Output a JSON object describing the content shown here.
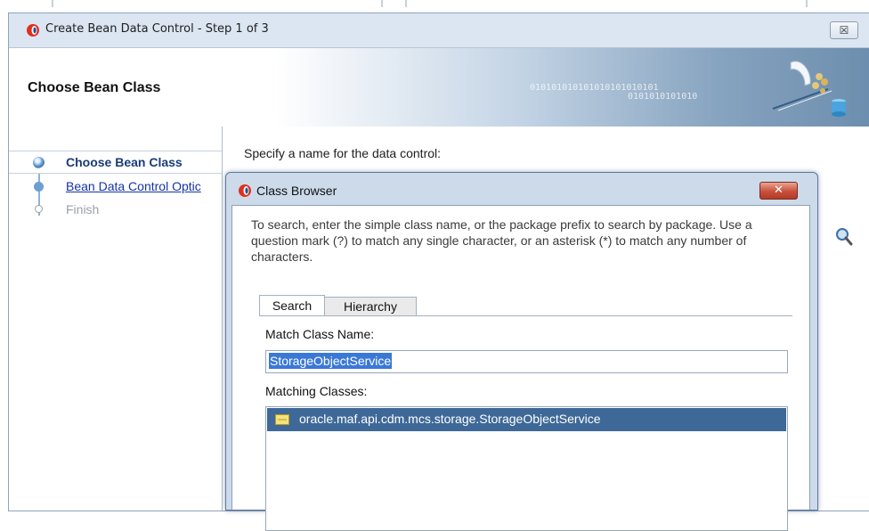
{
  "wizard": {
    "title": "Create Bean Data Control - Step 1 of 3",
    "close_label": "☒",
    "header_title": "Choose Bean Class",
    "header_binary_1": "010101010101010101010101",
    "header_binary_2": "0101010101010"
  },
  "steps": [
    {
      "label": "Choose Bean Class",
      "state": "active"
    },
    {
      "label": "Bean Data Control Optic",
      "state": "link"
    },
    {
      "label": "Finish",
      "state": "disabled"
    }
  ],
  "content": {
    "prompt": "Specify a name for the data control:"
  },
  "dialog": {
    "title": "Class Browser",
    "close_label": "✕",
    "description": "To search, enter the simple class name, or the package prefix to search by package. Use a question mark (?) to match any single character, or an asterisk (*) to match any number of characters.",
    "tabs": [
      "Search",
      "Hierarchy"
    ],
    "match_class_label": "Match Class Name:",
    "match_class_value": "StorageObjectService",
    "matching_classes_label": "Matching Classes:",
    "matching_classes": [
      "oracle.maf.api.cdm.mcs.storage.StorageObjectService"
    ]
  },
  "colors": {
    "selection": "#3e6897",
    "link": "#1433a8",
    "active_step": "#1a3b78"
  }
}
